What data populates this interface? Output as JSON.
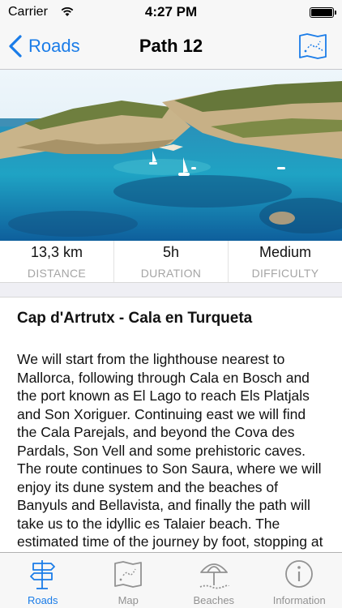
{
  "status_bar": {
    "carrier": "Carrier",
    "time": "4:27 PM"
  },
  "nav": {
    "back_label": "Roads",
    "title": "Path 12",
    "map_icon": "map-icon"
  },
  "stats": [
    {
      "value": "13,3 km",
      "label": "DISTANCE"
    },
    {
      "value": "5h",
      "label": "DURATION"
    },
    {
      "value": "Medium",
      "label": "DIFFICULTY"
    }
  ],
  "content": {
    "title": "Cap d'Artrutx - Cala en Turqueta",
    "body": "We will start from the lighthouse nearest to Mallorca, following through Cala en Bosch and the port known as El Lago to reach Els Platjals and Son Xoriguer. Continuing east we will find the Cala Parejals, and beyond the Cova des Pardals, Son Vell and some prehistoric caves. The route continues to Son Saura, where we will enjoy its dune system and the beaches of Banyuls and Bellavista, and finally the path will take us to the idyllic es Talaier beach. The estimated time of the journey by foot, stopping at the"
  },
  "tabs": [
    {
      "label": "Roads",
      "icon": "signpost-icon",
      "active": true
    },
    {
      "label": "Map",
      "icon": "map-icon",
      "active": false
    },
    {
      "label": "Beaches",
      "icon": "umbrella-icon",
      "active": false
    },
    {
      "label": "Information",
      "icon": "info-icon",
      "active": false
    }
  ],
  "colors": {
    "accent": "#1a7ce8",
    "inactive": "#929292",
    "sea": "#1fa3c4"
  }
}
